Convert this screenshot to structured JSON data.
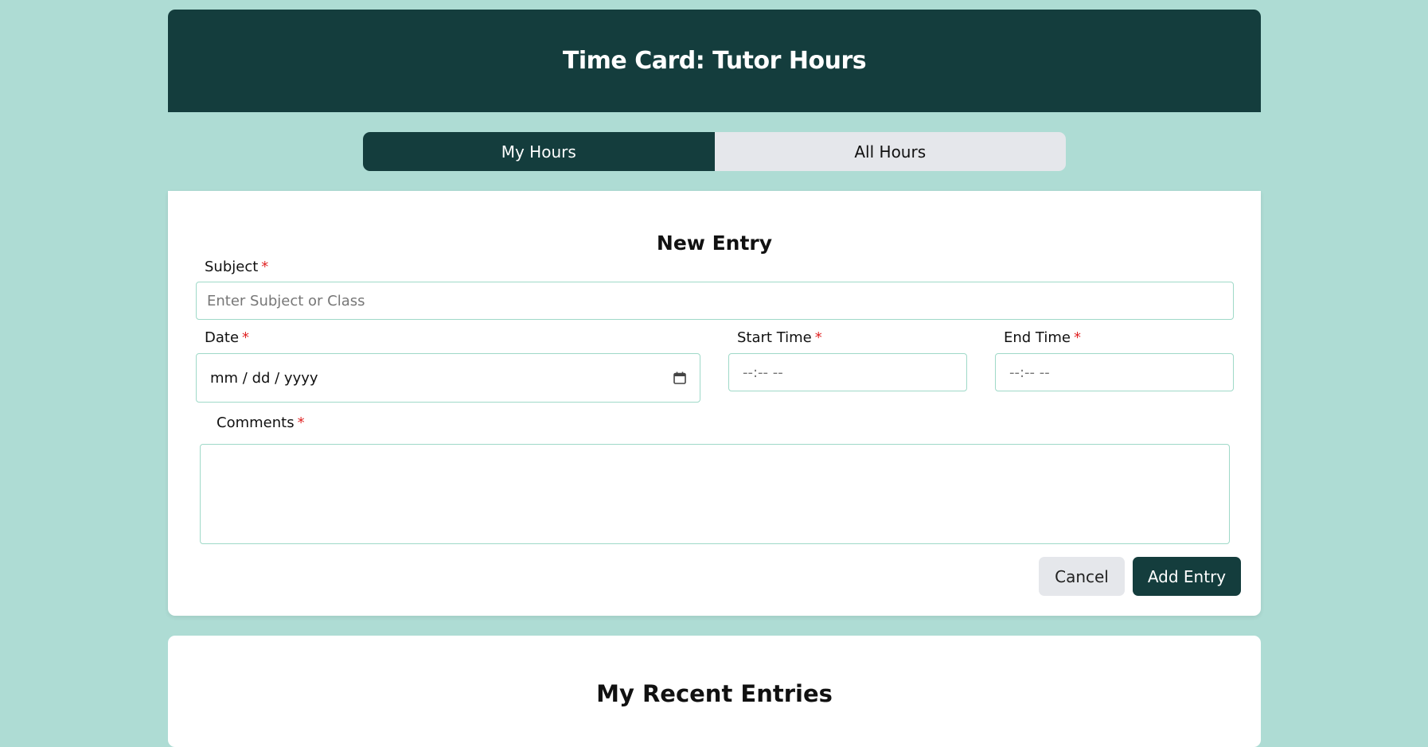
{
  "header": {
    "title": "Time Card: Tutor Hours"
  },
  "tabs": [
    {
      "label": "My Hours",
      "active": true
    },
    {
      "label": "All Hours",
      "active": false
    }
  ],
  "form": {
    "title": "New Entry",
    "required_marker": "*",
    "subject": {
      "label": "Subject",
      "placeholder": "Enter Subject or Class"
    },
    "date": {
      "label": "Date",
      "value": "mm / dd / yyyy",
      "icon": "calendar-icon"
    },
    "start_time": {
      "label": "Start Time",
      "value": "--:--  --"
    },
    "end_time": {
      "label": "End Time",
      "value": "--:--  --"
    },
    "comments": {
      "label": "Comments",
      "value": ""
    },
    "cancel_label": "Cancel",
    "add_label": "Add Entry"
  },
  "recent": {
    "title": "My Recent Entries"
  },
  "colors": {
    "page_bg": "#aedcd4",
    "accent": "#143d3d",
    "required": "#e02424",
    "field_border": "#9fd9c8"
  }
}
